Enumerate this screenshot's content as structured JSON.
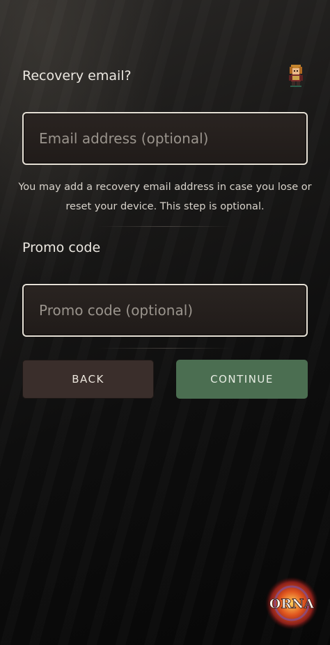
{
  "recovery": {
    "label": "Recovery email?",
    "email_placeholder": "Email address (optional)",
    "help_text": "You may add a recovery email address in case you lose or reset your device. This step is optional."
  },
  "promo": {
    "label": "Promo code",
    "placeholder": "Promo code (optional)"
  },
  "buttons": {
    "back": "BACK",
    "continue": "CONTINUE"
  },
  "branding": {
    "logo_text": "ORNA",
    "logo_icon": "orna-logo-icon",
    "avatar_icon": "character-avatar-icon"
  },
  "colors": {
    "continue_bg": "#4b6e51",
    "back_bg": "#3a2e2b",
    "field_border": "#e7e1d6"
  }
}
